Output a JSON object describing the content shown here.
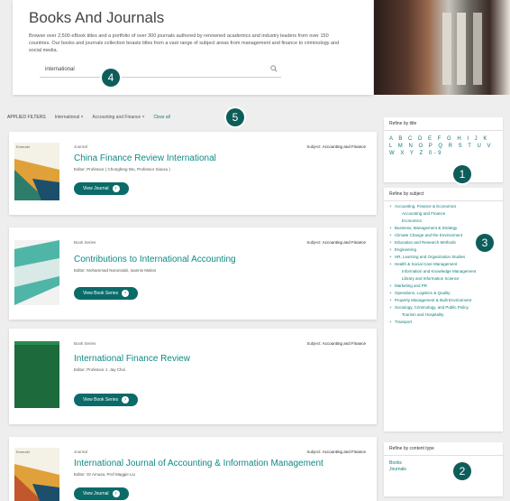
{
  "hero": {
    "title": "Books And Journals",
    "description": "Browse over 2,500 eBook titles and a portfolio of over 300 journals authored by renowned academics and industry leaders from over 150 countries. Our books and journals collection boasts titles from a vast range of subject areas from management and finance to criminology and social media.",
    "search_value": "international",
    "search_icon": "search-icon"
  },
  "applied": {
    "label": "APPLIED FILTERS",
    "chips": [
      "International ×",
      "Accounting and Finance ×"
    ],
    "clear": "Clear all"
  },
  "badges": [
    "1",
    "2",
    "3",
    "4",
    "5"
  ],
  "cards": [
    {
      "type": "Journal",
      "subject_label": "Subject:",
      "subject": "Accounting and Finance",
      "title": "China Finance Review International",
      "editor": "Editor: Professor ( Chongfeng Wu, Professor Xiaoxu )",
      "button": "View Journal",
      "logo": "Emerald"
    },
    {
      "type": "Book Series",
      "subject_label": "Subject:",
      "subject": "Accounting and Finance",
      "title": "Contributions to International Accounting",
      "editor": "Editor: Mohammad Nurunnabi, Ioannis Malios",
      "button": "View Book Series",
      "logo": ""
    },
    {
      "type": "Book Series",
      "subject_label": "Subject:",
      "subject": "Accounting and Finance",
      "title": "International Finance Review",
      "editor": "Editor: Professor J. Jay Choi",
      "button": "View Book Series",
      "logo": ""
    },
    {
      "type": "Journal",
      "subject_label": "Subject:",
      "subject": "Accounting and Finance",
      "title": "International Journal of Accounting & Information Management",
      "editor": "Editor: Dr Amusa, Prof Maggie Liu",
      "button": "View Journal",
      "logo": "Emerald"
    }
  ],
  "sidebar": {
    "refine_title": "Refine by title",
    "alphabet": "A B C D E F G H I J K L M N O P Q R S T U V W X Y Z 0-9",
    "refine_subject": "Refine by subject",
    "subjects": [
      {
        "label": "Accounting, Finance & Economics",
        "sub": false
      },
      {
        "label": "Accounting and Finance",
        "sub": true
      },
      {
        "label": "Economics",
        "sub": true
      },
      {
        "label": "Business, Management & Strategy",
        "sub": false
      },
      {
        "label": "Climate Change and the Environment",
        "sub": false
      },
      {
        "label": "Education and Research Methods",
        "sub": false
      },
      {
        "label": "Engineering",
        "sub": false
      },
      {
        "label": "HR, Learning and Organization Studies",
        "sub": false
      },
      {
        "label": "Health & Social Care Management",
        "sub": false
      },
      {
        "label": "Information and Knowledge Management",
        "sub": true
      },
      {
        "label": "Library and Information Science",
        "sub": true
      },
      {
        "label": "Marketing and PR",
        "sub": false
      },
      {
        "label": "Operations, Logistics & Quality",
        "sub": false
      },
      {
        "label": "Property Management & Built Environment",
        "sub": false
      },
      {
        "label": "Sociology, Criminology, and Public Policy",
        "sub": false
      },
      {
        "label": "Tourism and Hospitality",
        "sub": true
      },
      {
        "label": "Transport",
        "sub": false
      }
    ],
    "refine_content": "Refine by content type",
    "content_types": [
      "Books",
      "Journals"
    ]
  },
  "colors": {
    "accent": "#0f7b7b",
    "button": "#0b6b69",
    "badge": "#0d5d5a"
  }
}
